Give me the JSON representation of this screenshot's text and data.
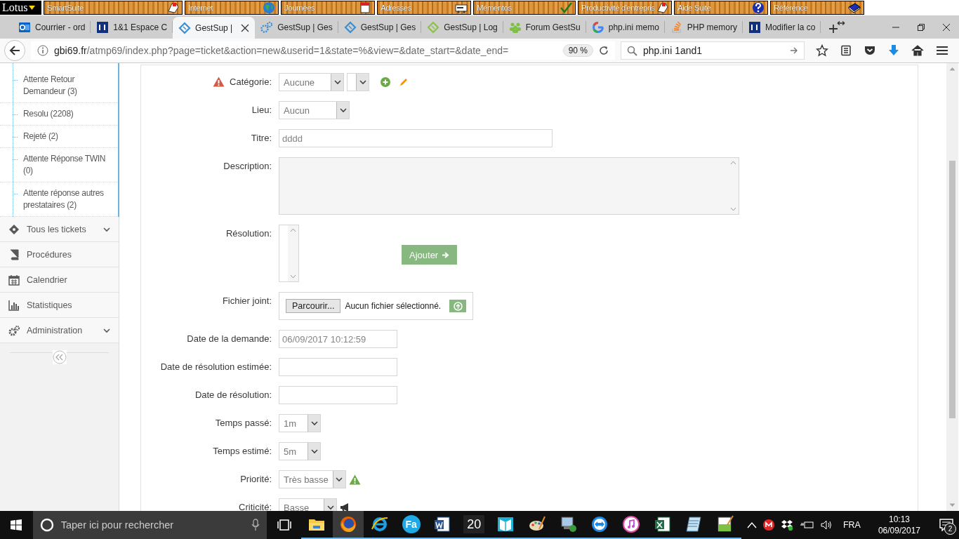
{
  "lotus_bar": {
    "logo": "Lotus",
    "items": [
      {
        "label": "SmartSuite",
        "kind": "hand"
      },
      {
        "label": "Internet",
        "kind": "globe"
      },
      {
        "label": "Journées",
        "kind": "calendar"
      },
      {
        "label": "Adresses",
        "kind": "cards"
      },
      {
        "label": "Mémentos",
        "kind": "check"
      },
      {
        "label": "Productivité d'entrepris",
        "kind": "hand"
      },
      {
        "label": "Aide Suite",
        "kind": "help"
      },
      {
        "label": "Référence",
        "kind": "book"
      }
    ]
  },
  "tabs": [
    {
      "label": "Courrier - ord",
      "kind": "outlook",
      "selected": false
    },
    {
      "label": "1&1 Espace C",
      "kind": "square",
      "selected": false
    },
    {
      "label": "GestSup |",
      "kind": "ticket",
      "selected": true
    },
    {
      "label": "GestSup | Ges",
      "kind": "gears",
      "selected": false
    },
    {
      "label": "GestSup | Ges",
      "kind": "ticket",
      "selected": false
    },
    {
      "label": "GestSup | Log",
      "kind": "ticket-green",
      "selected": false
    },
    {
      "label": "Forum GestSu",
      "kind": "people",
      "selected": false
    },
    {
      "label": "php.ini memo",
      "kind": "google",
      "selected": false
    },
    {
      "label": "PHP memory",
      "kind": "stack",
      "selected": false
    },
    {
      "label": "Modifier la co",
      "kind": "square",
      "selected": false
    }
  ],
  "nav": {
    "url_host": "gbi69.fr",
    "url_path": "/atmp69/index.php?page=ticket&action=new&userid=1&state=%&view=&date_start=&date_end=",
    "zoom": "90 %",
    "search": "php.ini 1and1"
  },
  "sidebar": {
    "sub_items": [
      "Attente Retour Demandeur (3)",
      "Resolu (2208)",
      "Rejeté (2)",
      "Attente Réponse TWIN (0)",
      "Attente réponse autres prestataires (2)"
    ],
    "items": [
      {
        "label": "Tous les tickets",
        "kind": "ticket",
        "expandable": true
      },
      {
        "label": "Procédures",
        "kind": "book",
        "expandable": false
      },
      {
        "label": "Calendrier",
        "kind": "calendar",
        "expandable": false
      },
      {
        "label": "Statistiques",
        "kind": "chart",
        "expandable": false
      },
      {
        "label": "Administration",
        "kind": "gears",
        "expandable": true
      }
    ]
  },
  "form": [
    {
      "label": "Catégorie:",
      "kind": "category",
      "value": "Aucune",
      "required": true
    },
    {
      "label": "Lieu:",
      "kind": "select",
      "value": "Aucun",
      "required": false
    },
    {
      "label": "Titre:",
      "kind": "text",
      "value": "dddd",
      "required": false
    },
    {
      "label": "Description:",
      "kind": "textarea",
      "required": false
    },
    {
      "label": "Résolution:",
      "kind": "resolution",
      "button": "Ajouter",
      "required": false
    },
    {
      "label": "Fichier joint:",
      "kind": "file",
      "button": "Parcourir...",
      "status": "Aucun fichier sélectionné.",
      "required": false
    },
    {
      "label": "Date de la demande:",
      "kind": "date",
      "value": "06/09/2017 10:12:59",
      "required": false
    },
    {
      "label": "Date de résolution estimée:",
      "kind": "date",
      "required": false
    },
    {
      "label": "Date de résolution:",
      "kind": "date",
      "required": false
    },
    {
      "label": "Temps passé:",
      "kind": "small-select",
      "value": "1m",
      "required": false
    },
    {
      "label": "Temps estimé:",
      "kind": "small-select",
      "value": "5m",
      "required": false
    },
    {
      "label": "Priorité:",
      "kind": "priority",
      "value": "Très basse",
      "required": false
    },
    {
      "label": "Criticité:",
      "kind": "criticity",
      "value": "Basse",
      "required": false
    }
  ],
  "taskbar": {
    "search_placeholder": "Taper ici pour rechercher",
    "apps": [
      {
        "kind": "folder",
        "running": true,
        "selected": false
      },
      {
        "kind": "firefox",
        "running": true,
        "selected": true
      },
      {
        "kind": "ie",
        "running": true,
        "selected": false
      },
      {
        "kind": "round-tile",
        "label": "Fa",
        "running": true,
        "selected": false
      },
      {
        "kind": "word",
        "running": true,
        "selected": false
      },
      {
        "kind": "square-tile",
        "label": "20",
        "running": true,
        "selected": false
      },
      {
        "kind": "book",
        "running": true,
        "selected": false
      },
      {
        "kind": "palette",
        "running": true,
        "selected": false
      },
      {
        "kind": "computer",
        "running": true,
        "selected": false
      },
      {
        "kind": "remote",
        "running": true,
        "selected": false
      },
      {
        "kind": "music",
        "running": true,
        "selected": false
      },
      {
        "kind": "excel",
        "running": true,
        "selected": false
      },
      {
        "kind": "notepad",
        "running": true,
        "selected": false
      },
      {
        "kind": "editor",
        "running": true,
        "selected": false
      }
    ],
    "language": "FRA",
    "time": "10:13",
    "date": "06/09/2017",
    "notifications": "2"
  }
}
